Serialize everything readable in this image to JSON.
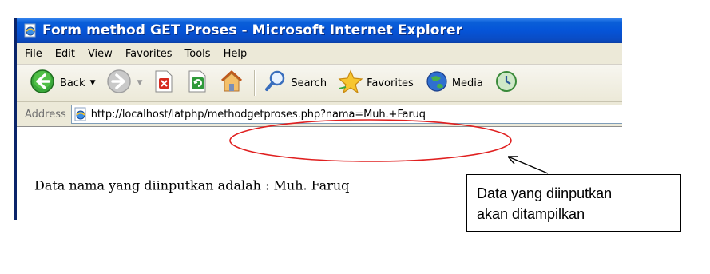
{
  "window": {
    "title": "Form method GET Proses - Microsoft Internet Explorer"
  },
  "menu": {
    "items": [
      "File",
      "Edit",
      "View",
      "Favorites",
      "Tools",
      "Help"
    ]
  },
  "toolbar": {
    "back_label": "Back",
    "search_label": "Search",
    "favorites_label": "Favorites",
    "media_label": "Media"
  },
  "address": {
    "label": "Address",
    "url": "http://localhost/latphp/methodgetproses.php?nama=Muh.+Faruq"
  },
  "content": {
    "text": "Data nama yang diinputkan adalah : Muh. Faruq"
  },
  "annotation": {
    "callout_line1": "Data yang diinputkan",
    "callout_line2": "akan ditampilkan",
    "ellipse_color": "#e02020"
  }
}
